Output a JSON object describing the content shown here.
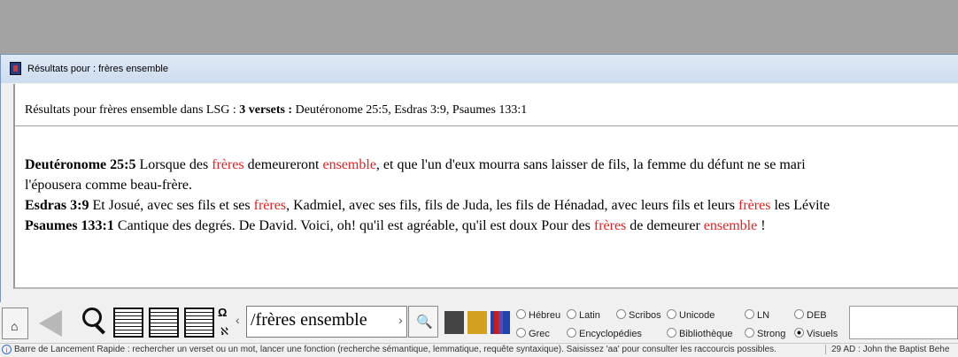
{
  "window": {
    "title": "Résultats pour : frères ensemble"
  },
  "summary": {
    "prefix": "Résultats pour frères ensemble dans LSG : ",
    "count": "3 versets :",
    "refs": " Deutéronome 25:5, Esdras 3:9, Psaumes 133:1"
  },
  "verses": [
    {
      "ref": "Deutéronome 25:5",
      "line1": [
        " Lorsque des ",
        "frères",
        " demeureront ",
        "ensemble",
        ", et que l'un d'eux mourra sans laisser de fils, la femme du défunt ne se mari"
      ],
      "line2": "l'épousera comme beau-frère."
    },
    {
      "ref": "Esdras 3:9",
      "line1": [
        " Et Josué, avec ses fils et ses ",
        "frères",
        ", Kadmiel, avec ses fils, fils de Juda, les fils de Hénadad, avec leurs fils et leurs ",
        "frères",
        " les Lévite"
      ]
    },
    {
      "ref": "Psaumes 133:1",
      "line1": [
        " Cantique des degrés. De David. Voici, oh! qu'il est agréable, qu'il est doux Pour des ",
        "frères",
        " de demeurer ",
        "ensemble",
        " !"
      ]
    }
  ],
  "toolbar": {
    "omega": "Ω",
    "aleph": "ℵ",
    "arrow_left": "‹",
    "arrow_right": "›",
    "search_value": "/frères ensemble",
    "options": [
      {
        "label": "Hébreu",
        "selected": false
      },
      {
        "label": "Latin",
        "selected": false
      },
      {
        "label": "Scribos",
        "selected": false
      },
      {
        "label": "Unicode",
        "selected": false
      },
      {
        "label": "LN",
        "selected": false
      },
      {
        "label": "DEB",
        "selected": false
      },
      {
        "label": "Grec",
        "selected": false
      },
      {
        "label": "Encyclopédies",
        "selected": false
      },
      {
        "label": "Bibliothèque",
        "selected": false
      },
      {
        "label": "Strong",
        "selected": false
      },
      {
        "label": "Visuels",
        "selected": true
      }
    ]
  },
  "status": {
    "icon": "i",
    "message": "Barre de Lancement Rapide : rechercher un verset ou un mot, lancer une fonction (recherche sémantique, lemmatique, requête syntaxique). Saisissez 'aa' pour consulter les raccourcis possibles.",
    "right": "29 AD : John the Baptist Behe"
  },
  "colors": {
    "highlight": "#e02020",
    "titlebar": "#d7e3f2",
    "background": "#a3a3a3"
  }
}
